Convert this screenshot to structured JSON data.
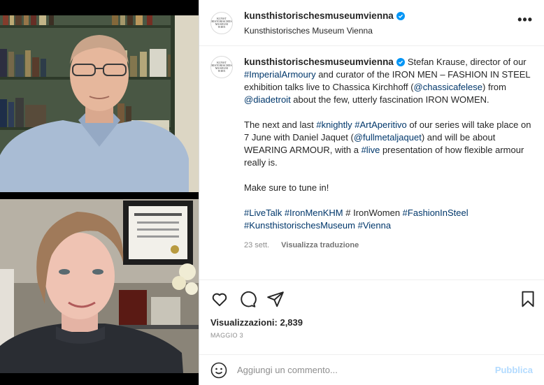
{
  "account": {
    "username": "kunsthistorischesmuseumvienna",
    "display_name": "Kunsthistorisches Museum Vienna",
    "logo_text": "KUNST HISTORISCHES MUSEUM WIEN"
  },
  "caption": {
    "p1_a": "Stefan Krause, director of our ",
    "p1_tag1": "#ImperialArmoury",
    "p1_b": " and curator of the IRON MEN – FASHION IN STEEL exhibition talks live to Chassica Kirchhoff (",
    "p1_tag2": "@chassicafelese",
    "p1_c": ") from ",
    "p1_tag3": "@diadetroit",
    "p1_d": " about the few, utterly fascination IRON WOMEN.",
    "p2_a": "The next and last ",
    "p2_tag1": "#knightly",
    "p2_tag2": "#ArtAperitivo",
    "p2_b": " of our series will take place on 7 June with Daniel Jaquet (",
    "p2_tag3": "@fullmetaljaquet",
    "p2_c": ") and will be about WEARING ARMOUR, with a ",
    "p2_tag4": "#live",
    "p2_d": " presentation of how flexible armour really is.",
    "p3": "Make sure to tune in!",
    "p4_tag1": "#LiveTalk",
    "p4_tag2": "#IronMenKHM",
    "p4_a": " # IronWomen ",
    "p4_tag3": "#FashionInSteel",
    "p4_tag4": "#KunsthistorischesMuseum",
    "p4_tag5": "#Vienna"
  },
  "meta": {
    "age": "23 sett.",
    "translate": "Visualizza traduzione"
  },
  "stats": {
    "views_label": "Visualizzazioni:",
    "views_value": "2,839",
    "date": "MAGGIO 3"
  },
  "composer": {
    "placeholder": "Aggiungi un commento...",
    "publish": "Pubblica"
  },
  "icons": {
    "more": "more-options-icon",
    "like": "heart-icon",
    "comment": "comment-icon",
    "share": "paper-plane-icon",
    "save": "bookmark-icon",
    "emoji": "emoji-icon",
    "verified": "verified-badge-icon"
  },
  "colors": {
    "link": "#00376b",
    "verified": "#0095f6",
    "muted": "#8e8e8e",
    "publish": "#b3dbff"
  }
}
